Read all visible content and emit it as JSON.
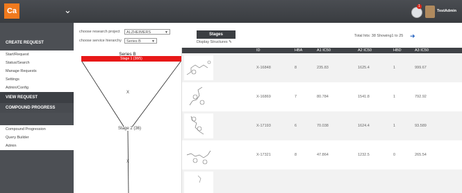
{
  "app": {
    "logo_text": "Ca",
    "username": "TestAdmin",
    "notification_count": "1"
  },
  "sidebar": {
    "section1": "CREATE REQUEST",
    "items1": [
      "Start/Request",
      "Status/Search",
      "Manage Requests",
      "Settings",
      "Admin/Config"
    ],
    "section2": "VIEW REQUEST",
    "section3": "COMPOUND PROGRESS",
    "items3": [
      "Compound Progression",
      "Query Builder",
      "Admin"
    ]
  },
  "controls": {
    "project_label": "choose research project",
    "project_value": "ALZHEIMERS",
    "hierarchy_label": "choose service hierarchy",
    "hierarchy_value": "Series B",
    "stages_button": "Stages",
    "display_structures": "Display Structures",
    "hits_text": "Total hits: 38 Showing1 to 25"
  },
  "tree": {
    "title": "Series B",
    "stage1": "Stage 1 (38/5)",
    "x1": "X",
    "stage2": "Stage 2 (36)",
    "x2": "X"
  },
  "table": {
    "headers": [
      "ID",
      "HBA",
      "A1 IC50",
      "A2 IC50",
      "HBD",
      "A3 IC50"
    ],
    "rows": [
      [
        "X-16848",
        "8",
        "235.83",
        "1625.4",
        "1",
        "999.67"
      ],
      [
        "X-16869",
        "7",
        "80.784",
        "1541.8",
        "1",
        "792.92"
      ],
      [
        "X-17193",
        "6",
        "70.038",
        "1624.4",
        "1",
        "93.589"
      ],
      [
        "X-17321",
        "8",
        "47.864",
        "1232.5",
        "0",
        "265.54"
      ]
    ]
  },
  "colors": {
    "accent": "#f07a1e",
    "stage_bar": "#e81818",
    "header": "#3f4246",
    "sidebar": "#4c4f54"
  }
}
